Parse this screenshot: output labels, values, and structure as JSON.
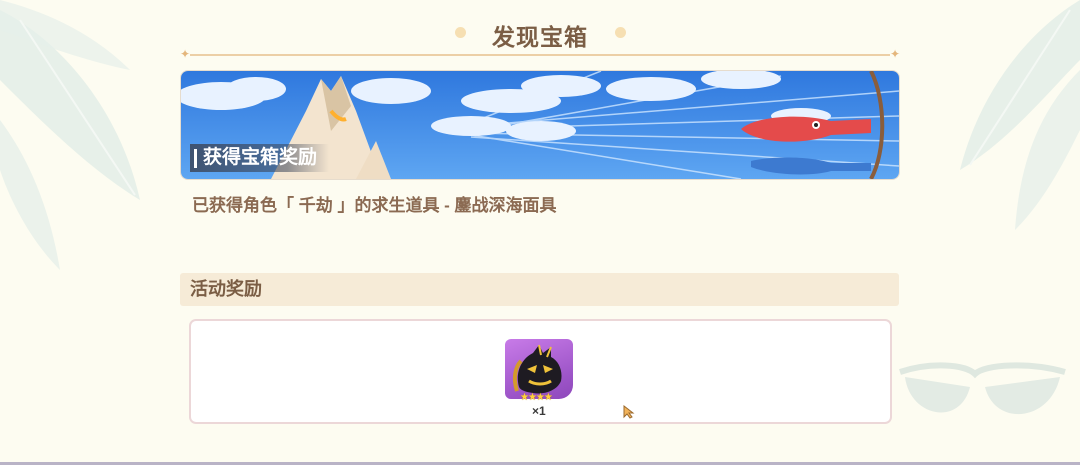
{
  "popup": {
    "title": "发现宝箱"
  },
  "banner": {
    "label": "获得宝箱奖励"
  },
  "description": "已获得角色「 千劫 」的求生道具 - 鏖战深海面具",
  "rewards": {
    "header": "活动奖励",
    "items": [
      {
        "icon": "dark-armor-mask-icon",
        "rarity_stars": 4,
        "stars_text": "★★★★",
        "count": "×1"
      }
    ]
  },
  "colors": {
    "background": "#fdfcf1",
    "title_text": "#7b5e45",
    "body_text": "#8b6a52",
    "section_header_bg": "#f6ebd7",
    "item_tile_purple": "#b06ad8",
    "banner_sky": "#3e86e3"
  }
}
